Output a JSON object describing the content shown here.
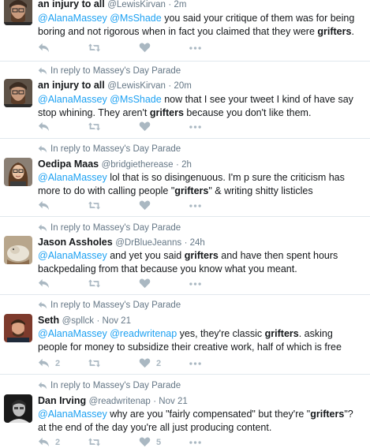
{
  "common": {
    "reply_context": "In reply to Massey's Day Parade"
  },
  "tweets": [
    {
      "name": "an injury to all",
      "handle": "@LewisKirvan",
      "time": "2m",
      "parts": [
        {
          "t": "@AlanaMassey",
          "m": true
        },
        {
          "t": " "
        },
        {
          "t": "@MsShade",
          "m": true
        },
        {
          "t": " you said your critique of them was for being boring and not rigorous when in fact you claimed that they were "
        },
        {
          "t": "grifters",
          "b": true
        },
        {
          "t": "."
        }
      ],
      "reply_count": "",
      "like_count": ""
    },
    {
      "name": "an injury to all",
      "handle": "@LewisKirvan",
      "time": "20m",
      "parts": [
        {
          "t": "@AlanaMassey",
          "m": true
        },
        {
          "t": " "
        },
        {
          "t": "@MsShade",
          "m": true
        },
        {
          "t": " now that I see your tweet I kind of have say stop whining. They aren't "
        },
        {
          "t": "grifters",
          "b": true
        },
        {
          "t": " because you don't like them."
        }
      ],
      "reply_count": "",
      "like_count": ""
    },
    {
      "name": "Oedipa Maas",
      "handle": "@bridgietherease",
      "time": "2h",
      "parts": [
        {
          "t": "@AlanaMassey",
          "m": true
        },
        {
          "t": " lol that is so disingenuous. I'm p sure the criticism has more to do with calling people \""
        },
        {
          "t": "grifters",
          "b": true
        },
        {
          "t": "\" & writing shitty listicles"
        }
      ],
      "reply_count": "",
      "like_count": ""
    },
    {
      "name": "Jason Assholes",
      "handle": "@DrBlueJeanns",
      "time": "24h",
      "parts": [
        {
          "t": "@AlanaMassey",
          "m": true
        },
        {
          "t": " and yet you said "
        },
        {
          "t": "grifters",
          "b": true
        },
        {
          "t": " and have then spent hours backpedaling from that because you know what you meant."
        }
      ],
      "reply_count": "",
      "like_count": ""
    },
    {
      "name": "Seth",
      "handle": "@spllck",
      "time": "Nov 21",
      "parts": [
        {
          "t": "@AlanaMassey",
          "m": true
        },
        {
          "t": " "
        },
        {
          "t": "@readwritenap",
          "m": true
        },
        {
          "t": " yes, they're classic "
        },
        {
          "t": "grifters",
          "b": true
        },
        {
          "t": ". asking people for money to subsidize their creative work, half of which is free"
        }
      ],
      "reply_count": "2",
      "like_count": "2"
    },
    {
      "name": "Dan Irving",
      "handle": "@readwritenap",
      "time": "Nov 21",
      "parts": [
        {
          "t": "@AlanaMassey",
          "m": true
        },
        {
          "t": " why are you \"fairly compensated\" but they're \""
        },
        {
          "t": "grifters",
          "b": true
        },
        {
          "t": "\"? at the end of the day you're all just producing content."
        }
      ],
      "reply_count": "2",
      "like_count": "5"
    }
  ]
}
